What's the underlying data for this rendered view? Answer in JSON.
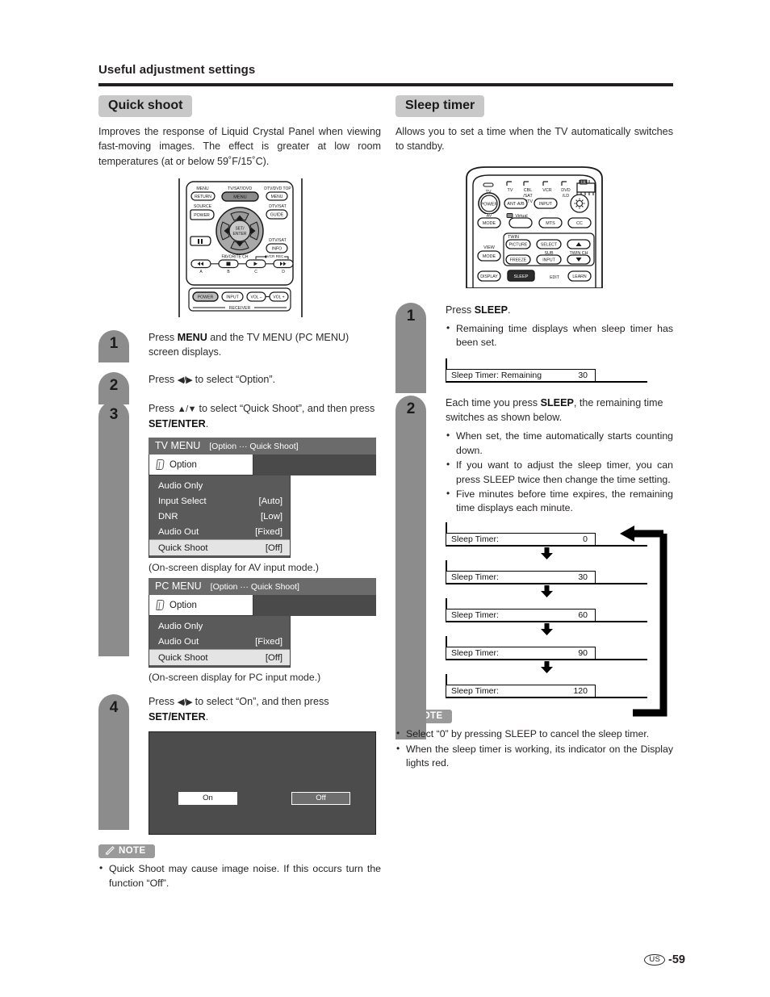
{
  "page": {
    "header": "Useful adjustment settings",
    "footer_region": "US",
    "footer_number": "-59"
  },
  "left": {
    "title": "Quick shoot",
    "description": "Improves the response of Liquid Crystal Panel when viewing fast-moving images. The effect is greater at low room temperatures (at or below 59˚F/15˚C).",
    "remote": {
      "name": "quick-shoot-remote",
      "labels": {
        "menu_top": "MENU",
        "tvsatdvd": "TV/SAT/DVD",
        "dtvdvdtop": "DTV/DVD TOP",
        "return": "RETURN",
        "menu_center": "MENU",
        "menu_right": "MENU",
        "source": "SOURCE",
        "dtvsat1": "DTV/SAT",
        "power": "POWER",
        "guide": "GUIDE",
        "dtvsat2": "DTV/SAT",
        "info": "INFO",
        "setenter": "SET/\nENTER",
        "set": "SET/",
        "enter": "ENTER",
        "favorite_ch": "FAVORITE CH",
        "vcr_rec": "VCR REC",
        "a": "A",
        "b": "B",
        "c": "C",
        "d": "D",
        "power2": "POWER",
        "input": "INPUT",
        "volminus": "VOL –",
        "volplus": "VOL +",
        "receiver": "RECEIVER"
      }
    },
    "steps": [
      {
        "num": "1",
        "text_parts": [
          "Press ",
          "MENU",
          " and the TV MENU (PC MENU) screen displays."
        ]
      },
      {
        "num": "2",
        "text_parts": [
          "Press ",
          "◀/▶",
          " to select “Option”."
        ]
      },
      {
        "num": "3",
        "text_parts": [
          "Press ",
          "▲/▼",
          " to select “Quick Shoot”, and then press ",
          "SET/ENTER",
          "."
        ]
      },
      {
        "num": "4",
        "text_parts": [
          "Press ",
          "◀/▶",
          " to select “On”, and then press ",
          "SET/ENTER",
          "."
        ]
      }
    ],
    "tv_menu": {
      "title": "TV MENU",
      "breadcrumb": "[Option ··· Quick Shoot]",
      "tab": "Option",
      "rows": [
        {
          "label": "Audio Only",
          "value": "",
          "selected": false
        },
        {
          "label": "Input Select",
          "value": "[Auto]",
          "selected": false
        },
        {
          "label": "DNR",
          "value": "[Low]",
          "selected": false
        },
        {
          "label": "Audio Out",
          "value": "[Fixed]",
          "selected": false
        },
        {
          "label": "Quick Shoot",
          "value": "[Off]",
          "selected": true
        }
      ],
      "caption": "(On-screen display for AV input mode.)"
    },
    "pc_menu": {
      "title": "PC MENU",
      "breadcrumb": "[Option ··· Quick Shoot]",
      "tab": "Option",
      "rows": [
        {
          "label": "Audio Only",
          "value": "",
          "selected": false
        },
        {
          "label": "Audio Out",
          "value": "[Fixed]",
          "selected": false
        },
        {
          "label": "Quick Shoot",
          "value": "[Off]",
          "selected": true
        }
      ],
      "caption": "(On-screen display for PC input mode.)"
    },
    "onoff": {
      "on": "On",
      "off": "Off",
      "selected": "On"
    },
    "note": {
      "label": "NOTE",
      "items": [
        "Quick Shoot may cause image noise. If this occurs turn the function “Off”."
      ]
    }
  },
  "right": {
    "title": "Sleep timer",
    "description": "Allows you to set a time when the TV automatically switches to standby.",
    "remote": {
      "name": "sleep-timer-remote",
      "labels": {
        "tv_ind": "TV",
        "dev_tv": "TV",
        "dev_cbl": "CBL\n/SAT\n/DTV",
        "dev_cbl1": "CBL",
        "dev_cbl2": "/SAT",
        "dev_cbl3": "/DTV",
        "dev_vcr": "VCR",
        "dev_dvd": "DVD",
        "dev_dvd2": "/LD",
        "power": "POWER",
        "av": "AV",
        "mode_av": "MODE",
        "antab": "ANT·A/B",
        "input": "INPUT",
        "virtual": "Virtual",
        "mts": "MTS",
        "cc": "CC",
        "twin": "TWIN",
        "picture": "PICTURE",
        "select": "SELECT",
        "view": "VIEW",
        "mode_view": "MODE",
        "freeze": "FREEZE",
        "sub": "SUB",
        "sub_input": "INPUT",
        "twin_ch": "TWIN CH",
        "display": "DISPLAY",
        "sleep": "SLEEP",
        "edit": "EDIT",
        "learn": "LEARN"
      }
    },
    "steps": [
      {
        "num": "1",
        "text_parts": [
          "Press ",
          "SLEEP",
          "."
        ],
        "bullets": [
          "Remaining time displays when sleep timer has been set."
        ]
      },
      {
        "num": "2",
        "text_parts": [
          "Each time you press ",
          "SLEEP",
          ", the remaining time switches as shown below."
        ],
        "bullets": [
          "When set, the time automatically starts counting down.",
          "If you want to adjust the sleep timer, you can press SLEEP twice then change the time setting.",
          "Five minutes before time expires, the remaining time displays each minute."
        ]
      }
    ],
    "remaining_strip": {
      "label": "Sleep Timer: Remaining",
      "value": "30"
    },
    "sequence": [
      {
        "label": "Sleep Timer:",
        "value": "0"
      },
      {
        "label": "Sleep Timer:",
        "value": "30"
      },
      {
        "label": "Sleep Timer:",
        "value": "60"
      },
      {
        "label": "Sleep Timer:",
        "value": "90"
      },
      {
        "label": "Sleep Timer:",
        "value": "120"
      }
    ],
    "note": {
      "label": "NOTE",
      "items": [
        "Select “0” by pressing SLEEP to cancel the sleep timer.",
        "When the sleep timer is working, its indicator on the Display lights red."
      ]
    }
  }
}
